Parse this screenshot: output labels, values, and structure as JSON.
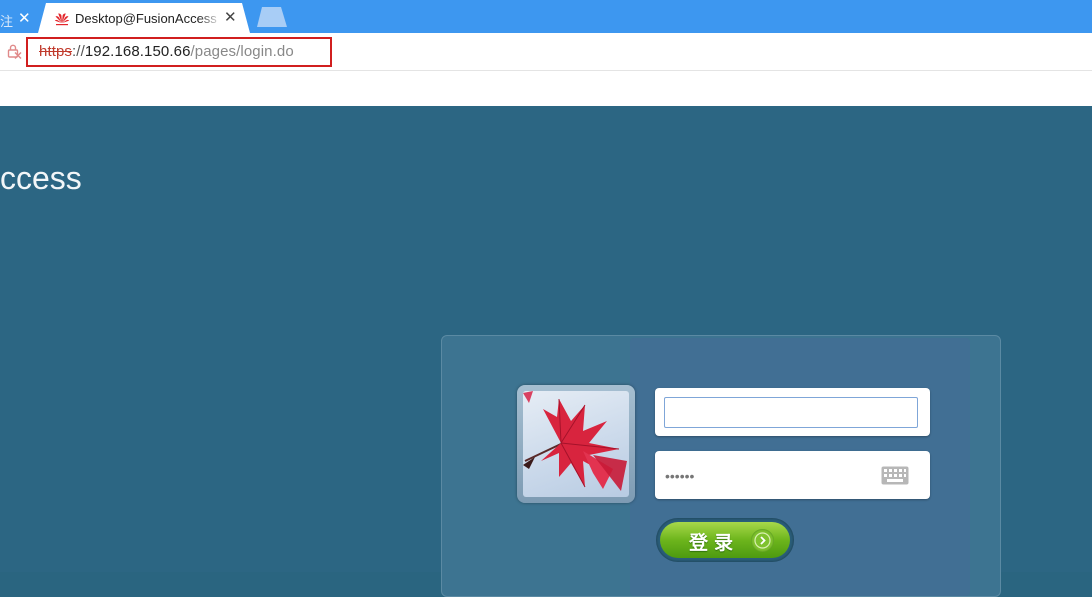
{
  "browser": {
    "prev_tab_fragment": "注",
    "active_tab_title": "Desktop@FusionAccess",
    "tab_close_glyph": "✕",
    "url": {
      "scheme": "https",
      "separator": "://",
      "host": "192.168.150.66",
      "path": "/pages/login.do"
    },
    "url_highlight_color": "#d11f1f"
  },
  "page": {
    "brand_fragment": "ccess",
    "background_color": "#2c6683"
  },
  "login": {
    "username_value": "",
    "password_mask": "••••••",
    "keyboard_icon": "soft-keyboard-icon",
    "submit_label": "登录",
    "submit_color": "#6db51c"
  }
}
